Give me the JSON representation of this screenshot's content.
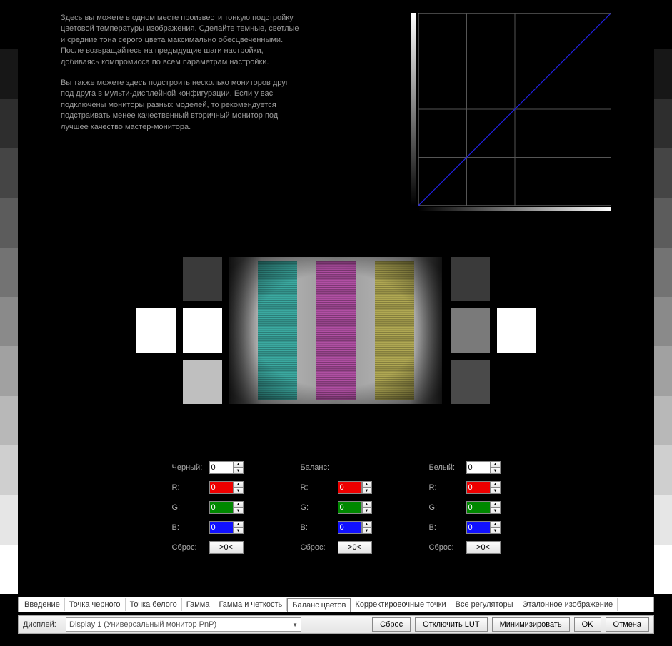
{
  "sideStripColors": [
    "#000000",
    "#171717",
    "#2e2e2e",
    "#454545",
    "#5c5c5c",
    "#737373",
    "#8a8a8a",
    "#a1a1a1",
    "#b8b8b8",
    "#cfcfcf",
    "#e6e6e6",
    "#ffffff"
  ],
  "description": {
    "p1": "Здесь вы можете в одном месте произвести тонкую подстройку цветовой температуры изображения. Сделайте темные, светлые и средние тона серого цвета максимально обесцвеченными. После возвращайтесь на предыдущие шаги настройки, добиваясь компромисса по всем параметрам настройки.",
    "p2": "Вы также можете здесь подстроить несколько мониторов друг под друга в мульти-дисплейной конфигурации. Если у вас подключены мониторы разных моделей, то рекомендуется подстраивать менее качественный вторичный монитор под лучшее качество мастер-монитора."
  },
  "swatches": {
    "leftTop": "#3a3a3a",
    "leftMid": "#ffffff",
    "leftBot": "#bfbfbf",
    "rightTop": "#3a3a3a",
    "rightMid": "#7a7a7a",
    "rightBot": "#4a4a4a",
    "farLeft": "#ffffff",
    "farRight": "#ffffff"
  },
  "controls": {
    "columns": [
      {
        "titleLabel": "Черный:",
        "titleValue": "0",
        "r": "0",
        "g": "0",
        "b": "0",
        "resetLabel": "Сброс:",
        "resetBtn": ">0<",
        "rLabel": "R:",
        "gLabel": "G:",
        "bLabel": "B:"
      },
      {
        "titleLabel": "Баланс:",
        "titleValue": "",
        "r": "0",
        "g": "0",
        "b": "0",
        "resetLabel": "Сброс:",
        "resetBtn": ">0<",
        "rLabel": "R:",
        "gLabel": "G:",
        "bLabel": "B:"
      },
      {
        "titleLabel": "Белый:",
        "titleValue": "0",
        "r": "0",
        "g": "0",
        "b": "0",
        "resetLabel": "Сброс:",
        "resetBtn": ">0<",
        "rLabel": "R:",
        "gLabel": "G:",
        "bLabel": "B:"
      }
    ]
  },
  "tabs": {
    "items": [
      "Введение",
      "Точка черного",
      "Точка белого",
      "Гамма",
      "Гамма и четкость",
      "Баланс цветов",
      "Корректировочные точки",
      "Все регуляторы",
      "Эталонное изображение"
    ],
    "activeIndex": 5
  },
  "bottomBar": {
    "displayLabel": "Дисплей:",
    "displayValue": "Display 1 (Универсальный монитор PnP)",
    "reset": "Сброс",
    "disableLut": "Отключить LUT",
    "minimize": "Минимизировать",
    "ok": "OK",
    "cancel": "Отмена"
  }
}
